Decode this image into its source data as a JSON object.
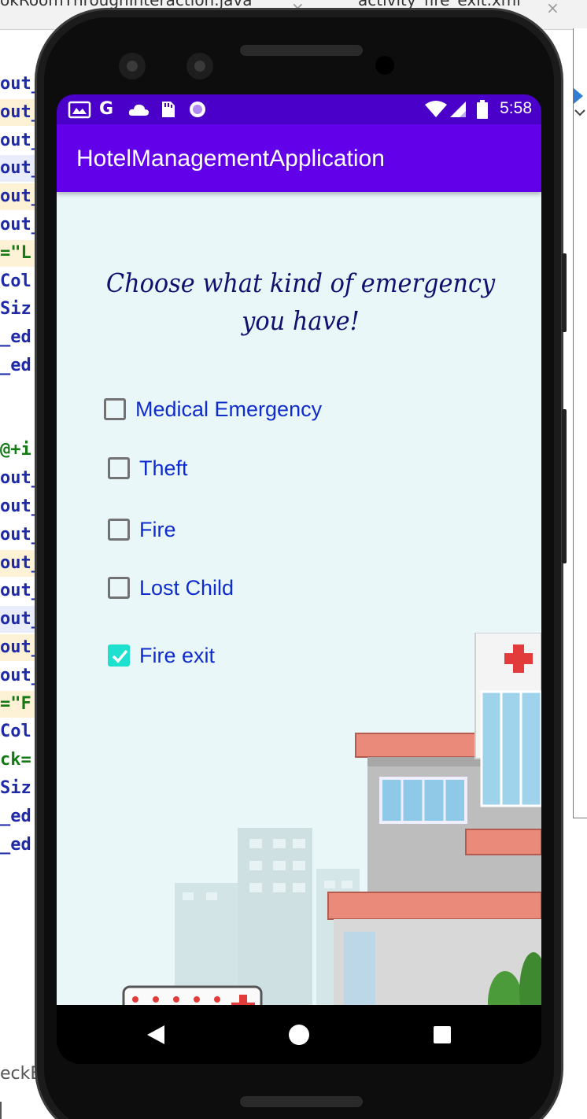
{
  "ide": {
    "tabs": [
      {
        "label": "okRoomThroughInteraction.java",
        "close": "×"
      },
      {
        "label": "activity_fire_exit.xml",
        "close": "×"
      }
    ],
    "code_lines": [
      {
        "text": "out_",
        "color": "#1f2aa8",
        "bg": "#ffffff"
      },
      {
        "text": "out_",
        "color": "#1f2aa8",
        "bg": "#fdf1d6"
      },
      {
        "text": "out_",
        "color": "#1f2aa8",
        "bg": "#ffffff"
      },
      {
        "text": "out_",
        "color": "#1f2aa8",
        "bg": "#e8ecfb"
      },
      {
        "text": "out_",
        "color": "#1f2aa8",
        "bg": "#fdf1d6"
      },
      {
        "text": "out_",
        "color": "#1f2aa8",
        "bg": "#ffffff"
      },
      {
        "text": "=\"L",
        "color": "#157a15",
        "bg": "#fdf1d6"
      },
      {
        "text": "Col",
        "color": "#1f2aa8",
        "bg": "#ffffff"
      },
      {
        "text": "Siz",
        "color": "#1f2aa8",
        "bg": "#ffffff"
      },
      {
        "text": "_ed",
        "color": "#1f2aa8",
        "bg": "#ffffff"
      },
      {
        "text": "_ed",
        "color": "#1f2aa8",
        "bg": "#ffffff"
      },
      {
        "text": "",
        "color": "#1f2aa8",
        "bg": "#ffffff"
      },
      {
        "text": "",
        "color": "#1f2aa8",
        "bg": "#ffffff"
      },
      {
        "text": "@+i",
        "color": "#157a15",
        "bg": "#ffffff"
      },
      {
        "text": "out_",
        "color": "#1f2aa8",
        "bg": "#ffffff"
      },
      {
        "text": "out_",
        "color": "#1f2aa8",
        "bg": "#ffffff"
      },
      {
        "text": "out_",
        "color": "#1f2aa8",
        "bg": "#ffffff"
      },
      {
        "text": "out_",
        "color": "#1f2aa8",
        "bg": "#fdf1d6"
      },
      {
        "text": "out_",
        "color": "#1f2aa8",
        "bg": "#ffffff"
      },
      {
        "text": "out_",
        "color": "#1f2aa8",
        "bg": "#e8ecfb"
      },
      {
        "text": "out_",
        "color": "#1f2aa8",
        "bg": "#fdf1d6"
      },
      {
        "text": "out_",
        "color": "#1f2aa8",
        "bg": "#ffffff"
      },
      {
        "text": "=\"F",
        "color": "#157a15",
        "bg": "#fdf1d6"
      },
      {
        "text": "Col",
        "color": "#1f2aa8",
        "bg": "#ffffff"
      },
      {
        "text": "ck=",
        "color": "#157a15",
        "bg": "#ffffff"
      },
      {
        "text": "Siz",
        "color": "#1f2aa8",
        "bg": "#ffffff"
      },
      {
        "text": "_ed",
        "color": "#1f2aa8",
        "bg": "#ffffff"
      },
      {
        "text": "_ed",
        "color": "#1f2aa8",
        "bg": "#ffffff"
      }
    ],
    "bottom_text": "eckB"
  },
  "status_bar": {
    "time": "5:58",
    "left_icons": [
      "gallery-icon",
      "google-icon",
      "cloud-icon",
      "sd-card-icon",
      "record-icon"
    ],
    "right_icons": [
      "wifi-icon",
      "signal-icon",
      "battery-icon"
    ]
  },
  "app_bar": {
    "title": "HotelManagementApplication"
  },
  "main": {
    "heading": "Choose what kind of emergency you have!",
    "checkboxes": [
      {
        "label": "Medical Emergency",
        "checked": false
      },
      {
        "label": "Theft",
        "checked": false
      },
      {
        "label": "Fire",
        "checked": false
      },
      {
        "label": "Lost Child",
        "checked": false
      },
      {
        "label": "Fire exit",
        "checked": true
      }
    ]
  },
  "colors": {
    "status_bar": "#4a00c8",
    "app_bar": "#6200ea",
    "content_bg": "#eaf7f9",
    "label": "#0f2ccd",
    "heading": "#10116e",
    "checkbox_checked": "#1ee0cf"
  },
  "nav_bar": {
    "buttons": [
      "back-icon",
      "home-icon",
      "recents-icon"
    ]
  }
}
